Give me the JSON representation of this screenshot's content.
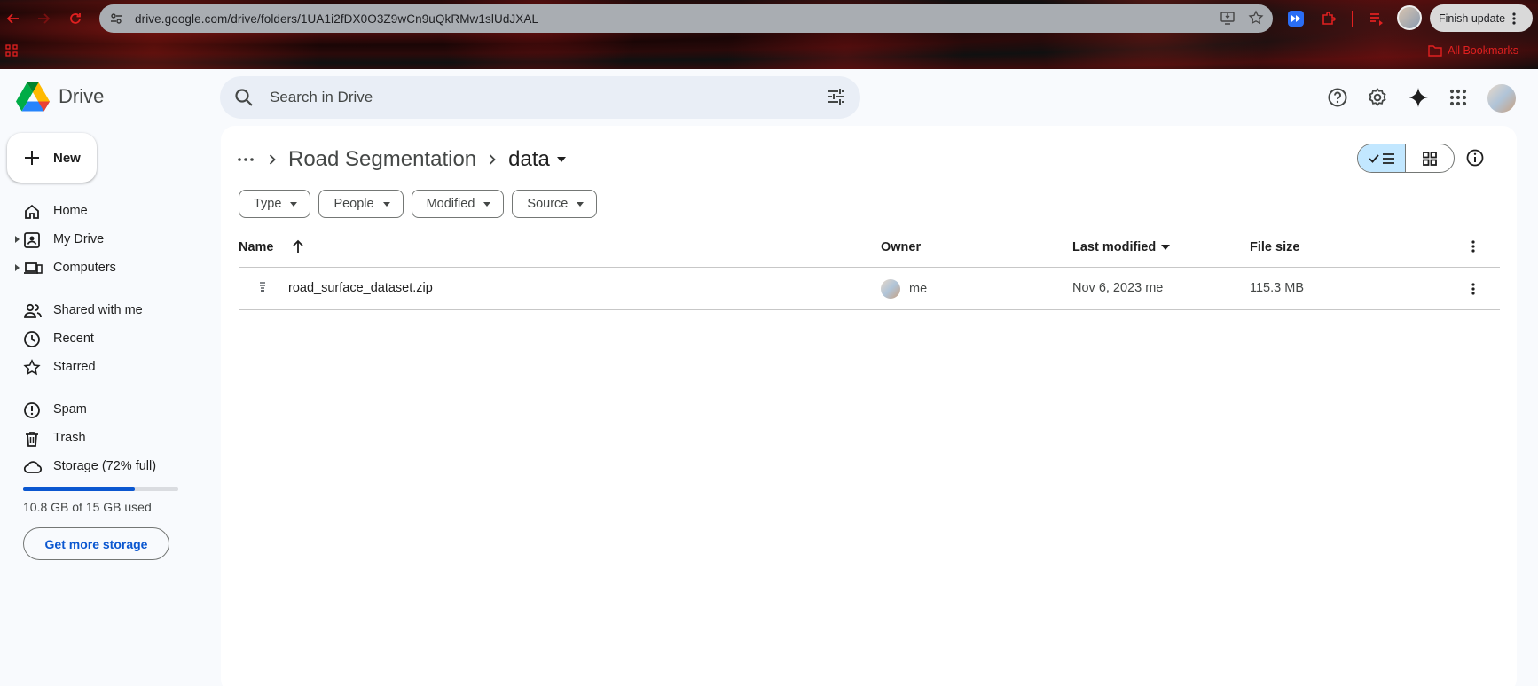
{
  "browser": {
    "url": "drive.google.com/drive/folders/1UA1i2fDX0O3Z9wCn9uQkRMw1slUdJXAL",
    "finish_update_label": "Finish update",
    "bookmarks_label": "All Bookmarks"
  },
  "app": {
    "name": "Drive",
    "search_placeholder": "Search in Drive"
  },
  "sidebar": {
    "new_label": "New",
    "items": [
      {
        "label": "Home",
        "icon": "home-icon"
      },
      {
        "label": "My Drive",
        "icon": "my-drive-icon"
      },
      {
        "label": "Computers",
        "icon": "computers-icon"
      },
      {
        "label": "Shared with me",
        "icon": "people-icon"
      },
      {
        "label": "Recent",
        "icon": "clock-icon"
      },
      {
        "label": "Starred",
        "icon": "star-icon"
      },
      {
        "label": "Spam",
        "icon": "spam-icon"
      },
      {
        "label": "Trash",
        "icon": "trash-icon"
      },
      {
        "label": "Storage (72% full)",
        "icon": "cloud-icon"
      }
    ],
    "storage_used_fraction": 0.72,
    "storage_text": "10.8 GB of 15 GB used",
    "get_more_storage_label": "Get more storage"
  },
  "breadcrumb": {
    "parent": "Road Segmentation",
    "current": "data"
  },
  "filters": [
    "Type",
    "People",
    "Modified",
    "Source"
  ],
  "table": {
    "columns": {
      "name": "Name",
      "owner": "Owner",
      "modified": "Last modified",
      "size": "File size"
    },
    "rows": [
      {
        "name": "road_surface_dataset.zip",
        "owner": "me",
        "modified": "Nov 6, 2023 me",
        "size": "115.3 MB"
      }
    ]
  },
  "colors": {
    "accent": "#0b57d0",
    "toggle_active": "#c2e7ff",
    "search_bg": "#e9eef6"
  }
}
